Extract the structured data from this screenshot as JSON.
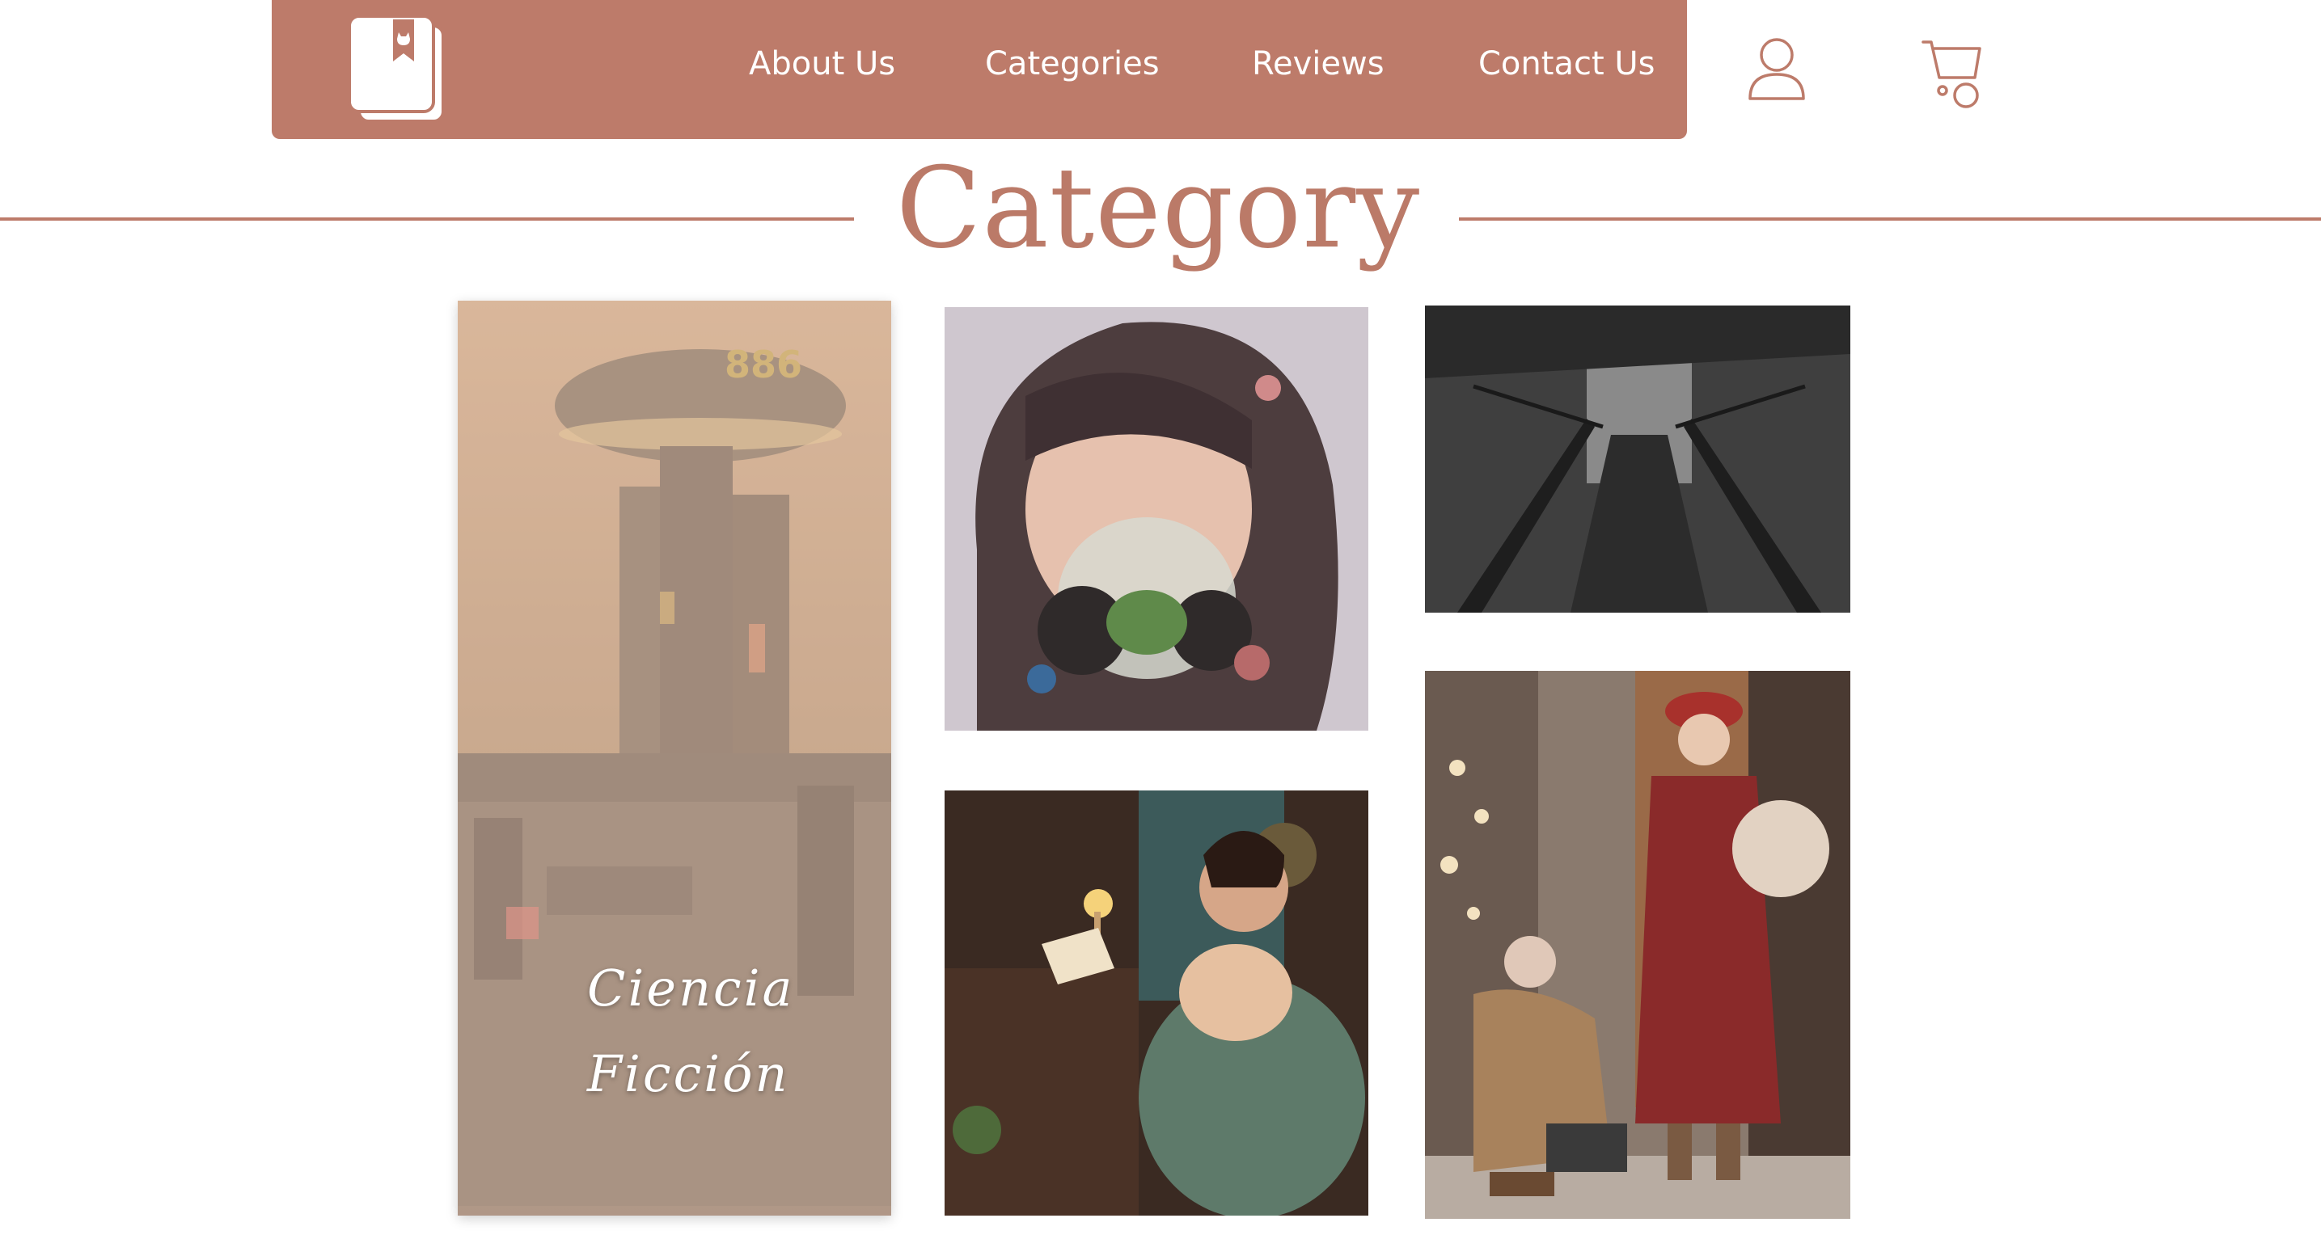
{
  "colors": {
    "brand": "#bd7b6a",
    "title": "#bb7a68",
    "white": "#ffffff"
  },
  "navbar": {
    "logo_icon": "book-bookmark-cat-icon",
    "links": [
      {
        "label": "About Us"
      },
      {
        "label": "Categories"
      },
      {
        "label": "Reviews"
      },
      {
        "label": "Contact Us"
      }
    ],
    "user_icon": "user-icon",
    "cart_icon": "cart-icon"
  },
  "section": {
    "title": "Category"
  },
  "gallery": {
    "cards": [
      {
        "label": "Ciencia\nFicción",
        "image": "sci-fi city with tower"
      },
      {
        "image": "girl with gas mask and flowers"
      },
      {
        "image": "dark foggy rope bridge"
      },
      {
        "image": "woman reading letter by candlelight"
      },
      {
        "image": "elderly couple with bouquet"
      }
    ]
  }
}
